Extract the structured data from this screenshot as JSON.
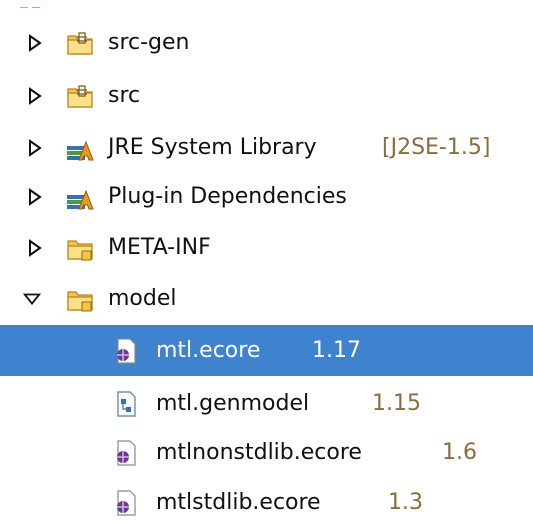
{
  "tree": {
    "items": [
      {
        "label": "src-gen",
        "decoration": "",
        "icon": "source-folder-icon",
        "state": "collapsed"
      },
      {
        "label": "src",
        "decoration": "",
        "icon": "source-folder-icon",
        "state": "collapsed"
      },
      {
        "label": "JRE System Library",
        "decoration": "[J2SE-1.5]",
        "icon": "library-icon",
        "state": "collapsed"
      },
      {
        "label": "Plug-in Dependencies",
        "decoration": "",
        "icon": "library-icon",
        "state": "collapsed"
      },
      {
        "label": "META-INF",
        "decoration": "",
        "icon": "folder-icon",
        "state": "collapsed"
      },
      {
        "label": "model",
        "decoration": "",
        "icon": "folder-icon",
        "state": "expanded"
      },
      {
        "label": "mtl.ecore",
        "decoration": "1.17",
        "icon": "ecore-file-icon",
        "state": "leaf",
        "selected": true
      },
      {
        "label": "mtl.genmodel",
        "decoration": "1.15",
        "icon": "genmodel-file-icon",
        "state": "leaf"
      },
      {
        "label": "mtlnonstdlib.ecore",
        "decoration": "1.6",
        "icon": "ecore-file-icon",
        "state": "leaf"
      },
      {
        "label": "mtlstdlib.ecore",
        "decoration": "1.3",
        "icon": "ecore-file-icon",
        "state": "leaf"
      }
    ]
  },
  "colors": {
    "selection": "#3f83cf",
    "decoration": "#8a6d3b",
    "folder": "#f2c55c",
    "library_books": "#3a6fb0"
  }
}
